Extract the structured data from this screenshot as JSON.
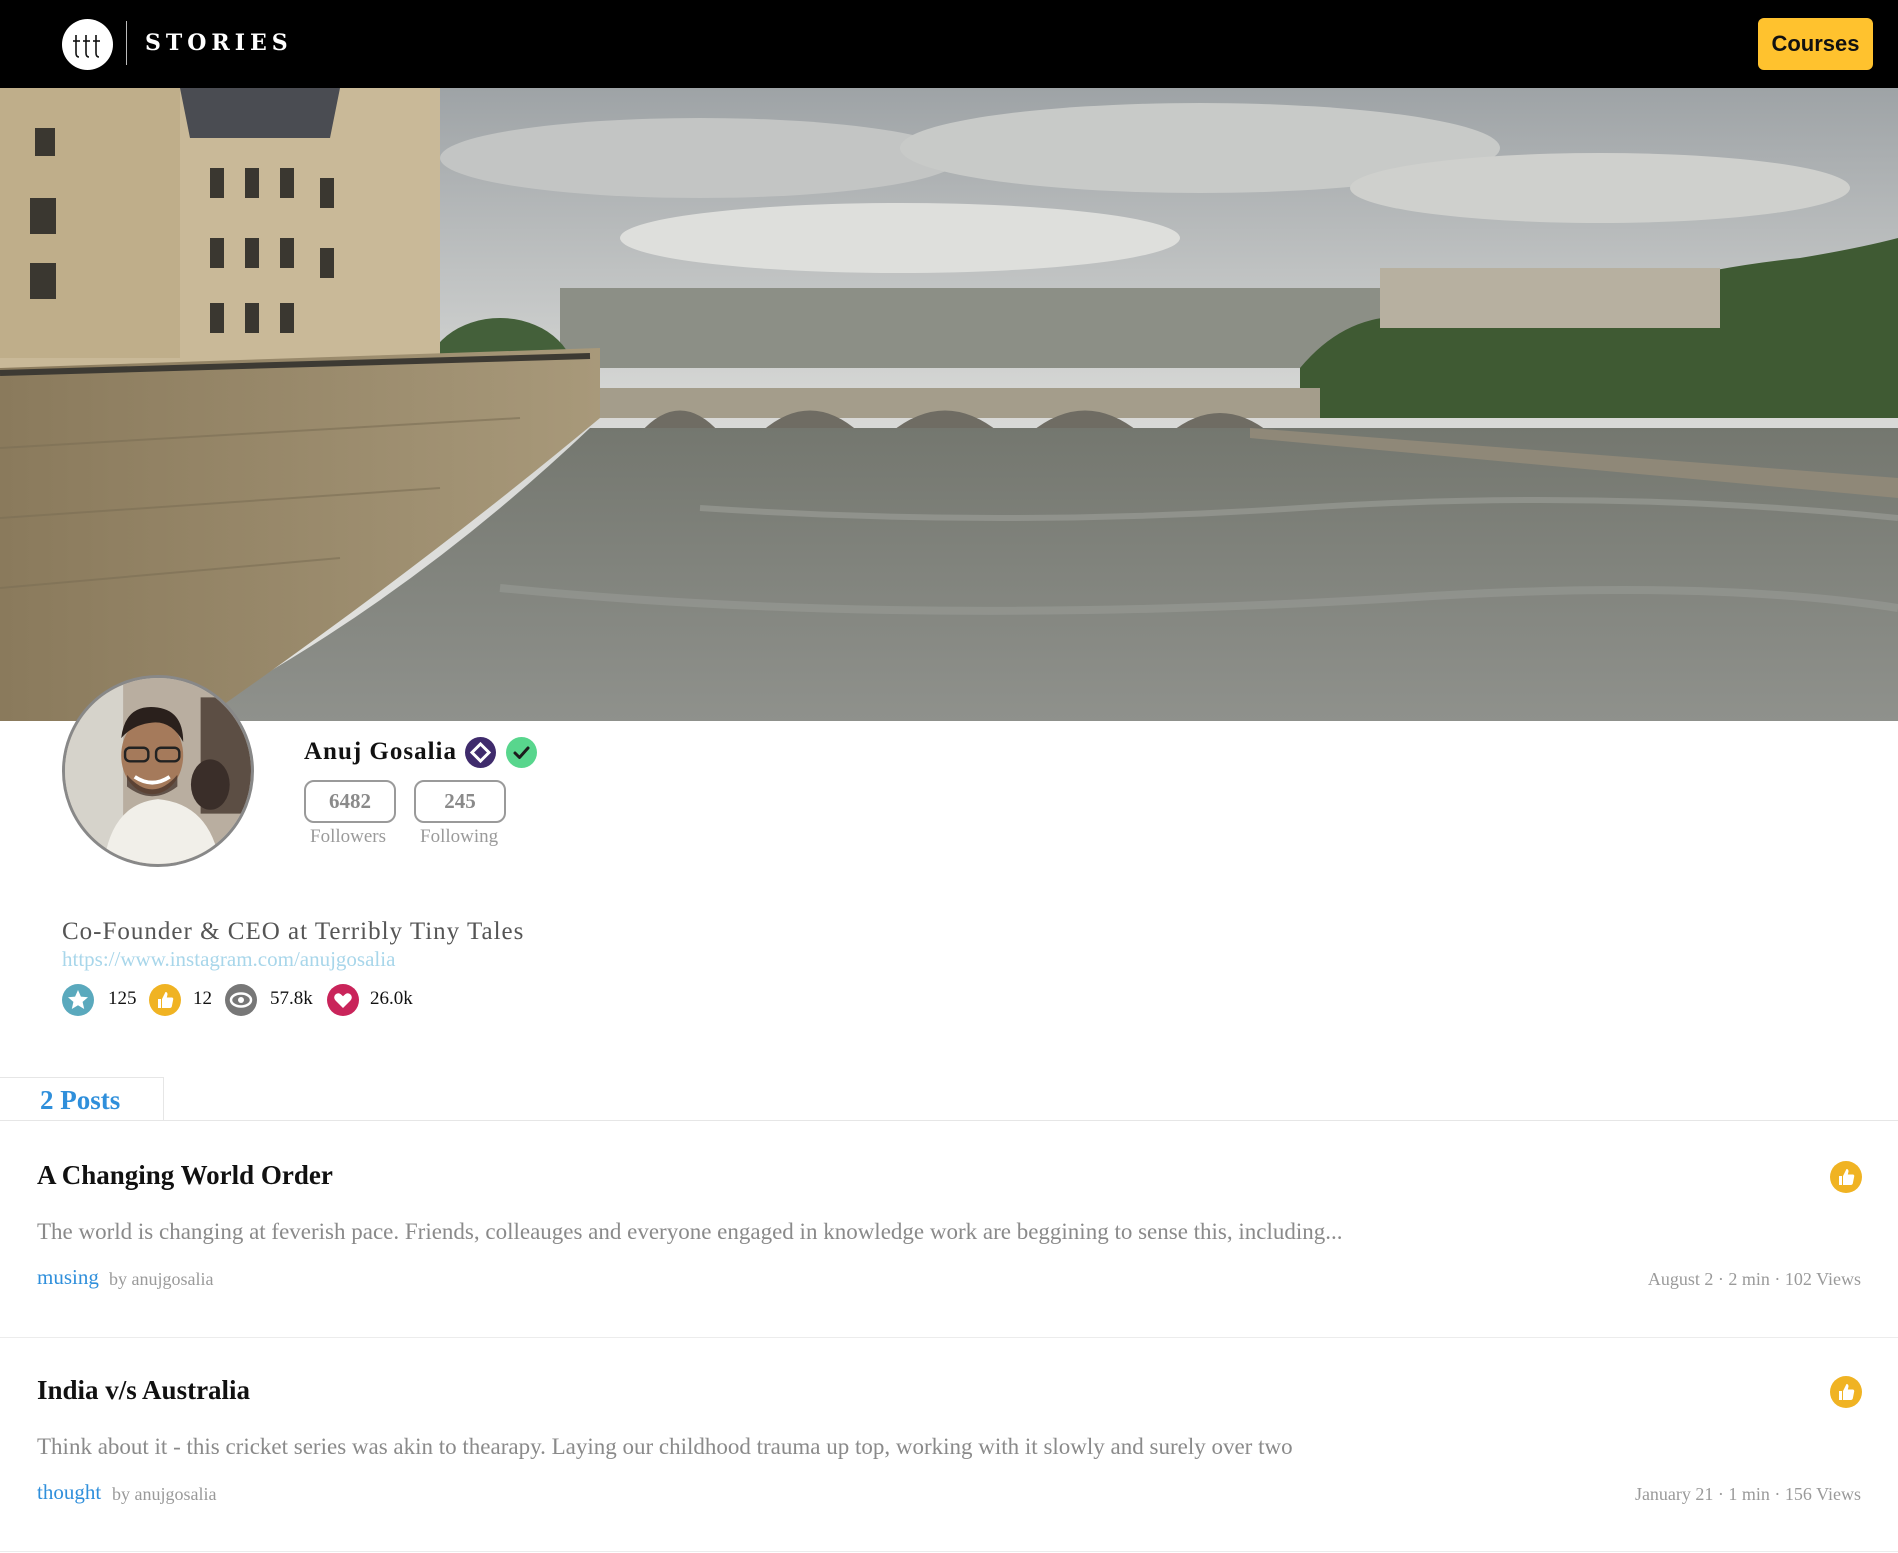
{
  "header": {
    "brand": "STORIES",
    "courses_label": "Courses"
  },
  "profile": {
    "name": "Anuj Gosalia",
    "followers_count": "6482",
    "followers_label": "Followers",
    "following_count": "245",
    "following_label": "Following",
    "bio": "Co-Founder & CEO at Terribly Tiny Tales",
    "link": "https://www.instagram.com/anujgosalia",
    "stats": [
      {
        "icon": "star-icon",
        "value": "125"
      },
      {
        "icon": "thumbs-up-icon",
        "value": "12"
      },
      {
        "icon": "eye-icon",
        "value": "57.8k"
      },
      {
        "icon": "heart-icon",
        "value": "26.0k"
      }
    ]
  },
  "tabs": {
    "posts_label": "2 Posts"
  },
  "posts": [
    {
      "title": "A Changing World Order",
      "excerpt": "The world is changing at feverish pace. Friends, colleauges and everyone engaged in knowledge work are beggining to sense this, including...",
      "tag": "musing",
      "by": "by anujgosalia",
      "meta": "August 2 · 2 min · 102 Views"
    },
    {
      "title": "India v/s Australia",
      "excerpt": "Think about it - this cricket series was akin to thearapy. Laying our childhood trauma up top, working with it slowly and surely over two",
      "tag": "thought",
      "by": "by anujgosalia",
      "meta": "January 21 · 1 min · 156 Views"
    }
  ],
  "colors": {
    "accent": "#2f8fdb",
    "courses_button": "#ffc22e",
    "like_button": "#f0b323",
    "verified": "#58d68d",
    "badge_purple": "#3f2b6c",
    "star": "#5aa9bd",
    "eye": "#777777",
    "heart": "#c9245a"
  }
}
